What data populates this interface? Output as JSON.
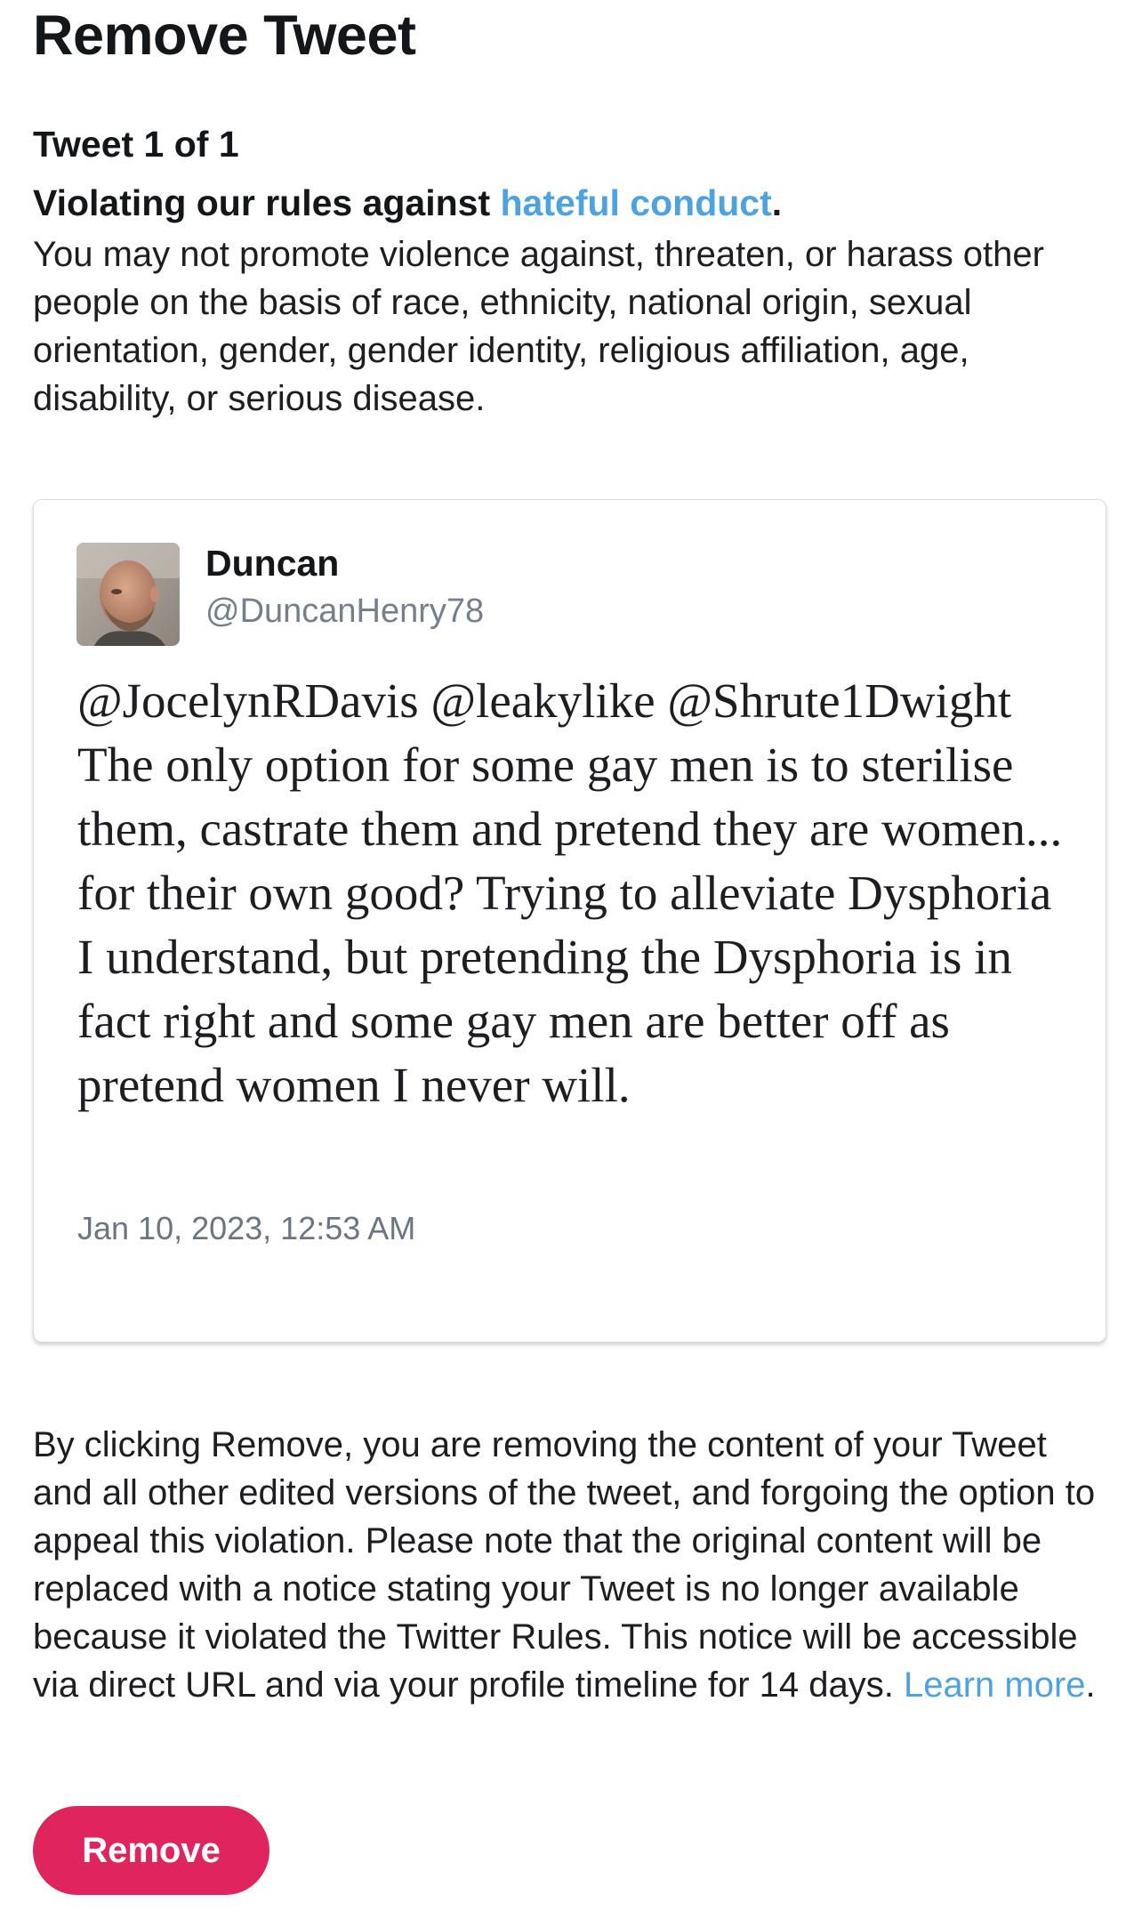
{
  "header": {
    "title": "Remove Tweet"
  },
  "violation": {
    "count_label": "Tweet 1 of 1",
    "heading_prefix": "Violating our rules against ",
    "rule_link": "hateful conduct",
    "heading_suffix": ".",
    "description": "You may not promote violence against, threaten, or harass other people on the basis of race, ethnicity, national origin, sexual orientation, gender, gender identity, religious affiliation, age, disability, or serious disease."
  },
  "tweet": {
    "author_name": "Duncan",
    "author_handle": "@DuncanHenry78",
    "avatar_icon": "user-avatar-photo",
    "text": "@JocelynRDavis @leakylike @Shrute1Dwight The only option for some gay men is to sterilise them, castrate them and pretend they are women... for their own good? Trying to alleviate Dysphoria I understand, but pretending the Dysphoria is in fact right and some gay men are better off as pretend women I never will.",
    "timestamp": "Jan 10, 2023, 12:53 AM"
  },
  "disclaimer": {
    "text": "By clicking Remove, you are removing the content of your Tweet and all other edited versions of the tweet, and forgoing the option to appeal this violation. Please note that the original content will be replaced with a notice stating your Tweet is no longer available because it violated the Twitter Rules. This notice will be accessible via direct URL and via your profile timeline for 14 days. ",
    "learn_more": "Learn more",
    "suffix": "."
  },
  "actions": {
    "remove_label": "Remove"
  },
  "colors": {
    "link": "#4da3e0",
    "remove_button": "#e0245e",
    "secondary_text": "#75808a"
  }
}
